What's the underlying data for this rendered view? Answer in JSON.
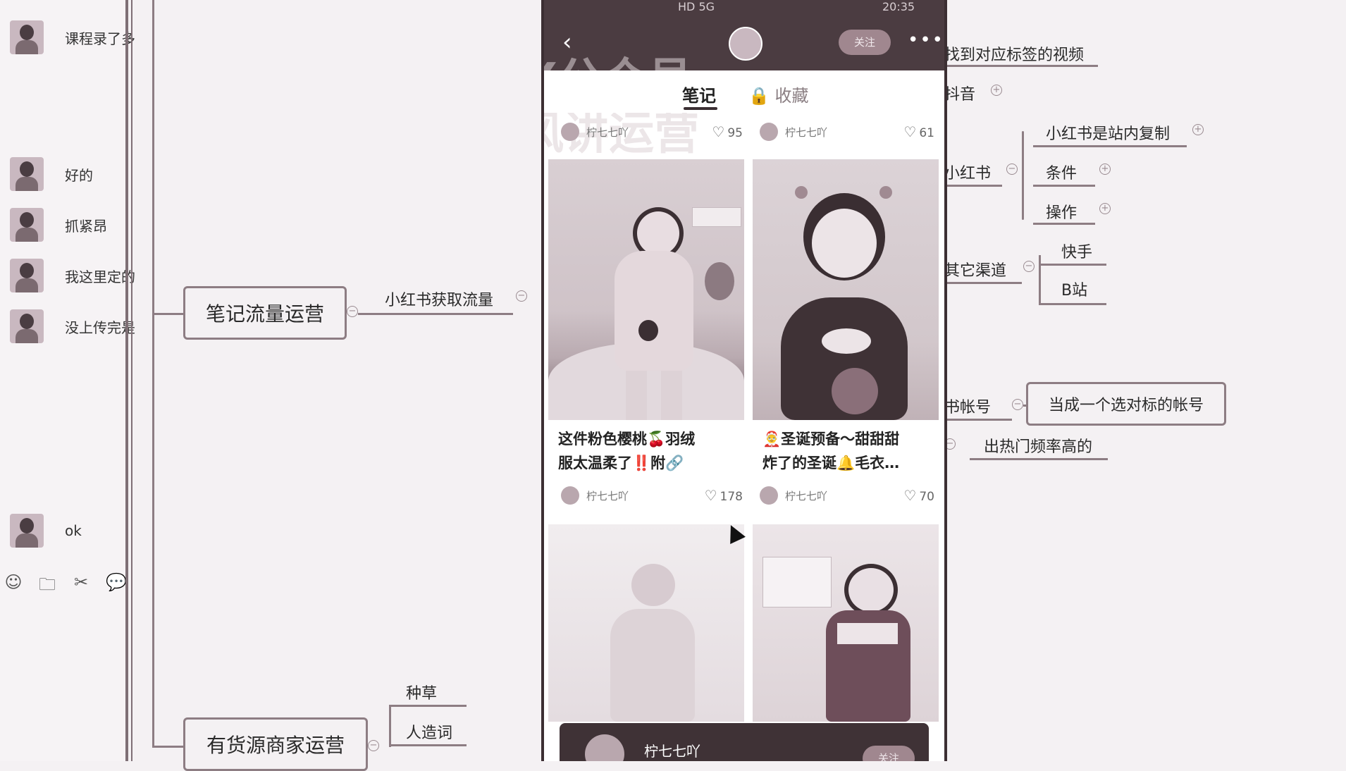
{
  "chat": {
    "messages": [
      {
        "text": "课程录了多"
      },
      {
        "text": "好的"
      },
      {
        "text": "抓紧昂"
      },
      {
        "text": "我这里定的"
      },
      {
        "text": "没上传完是"
      },
      {
        "text": "ok"
      }
    ],
    "toolbar": [
      "☺",
      "🗀",
      "✂",
      "💬"
    ]
  },
  "mindmap": {
    "root1": "笔记流量运营",
    "root1_child": "小红书获取流量",
    "root2": "有货源商家运营",
    "root2_children": [
      "种草",
      "人造词"
    ],
    "right": {
      "find_video": "找到对应标签的视频",
      "douyin": "抖音",
      "xhs": "小红书",
      "xhs_children": [
        "小红书是站内复制",
        "条件",
        "操作"
      ],
      "other": "其它渠道",
      "other_children": [
        "快手",
        "B站"
      ],
      "account": "书帐号",
      "account_child": "当成一个选对标的帐号",
      "hot": "出热门频率高的"
    }
  },
  "phone": {
    "status_time": "20:35",
    "status_left": "HD 5G",
    "watermark1": "VX公众号",
    "watermark2": "和风讲运营",
    "follow_label": "关注",
    "tabs": {
      "notes": "笔记",
      "favorites": "收藏"
    },
    "top_row": [
      {
        "author": "柠七七吖",
        "likes": "95"
      },
      {
        "author": "柠七七吖",
        "likes": "61"
      }
    ],
    "cards": [
      {
        "title_line1": "这件粉色樱桃🍒羽绒",
        "title_line2": "服太温柔了‼️附🔗",
        "author": "柠七七吖",
        "likes": "178"
      },
      {
        "title_line1": "🤶圣诞预备～甜甜甜",
        "title_line2": "炸了的圣诞🔔毛衣…",
        "author": "柠七七吖",
        "likes": "70"
      }
    ],
    "bottom_bar": {
      "name": "柠七七吖",
      "follow": "关注"
    }
  }
}
